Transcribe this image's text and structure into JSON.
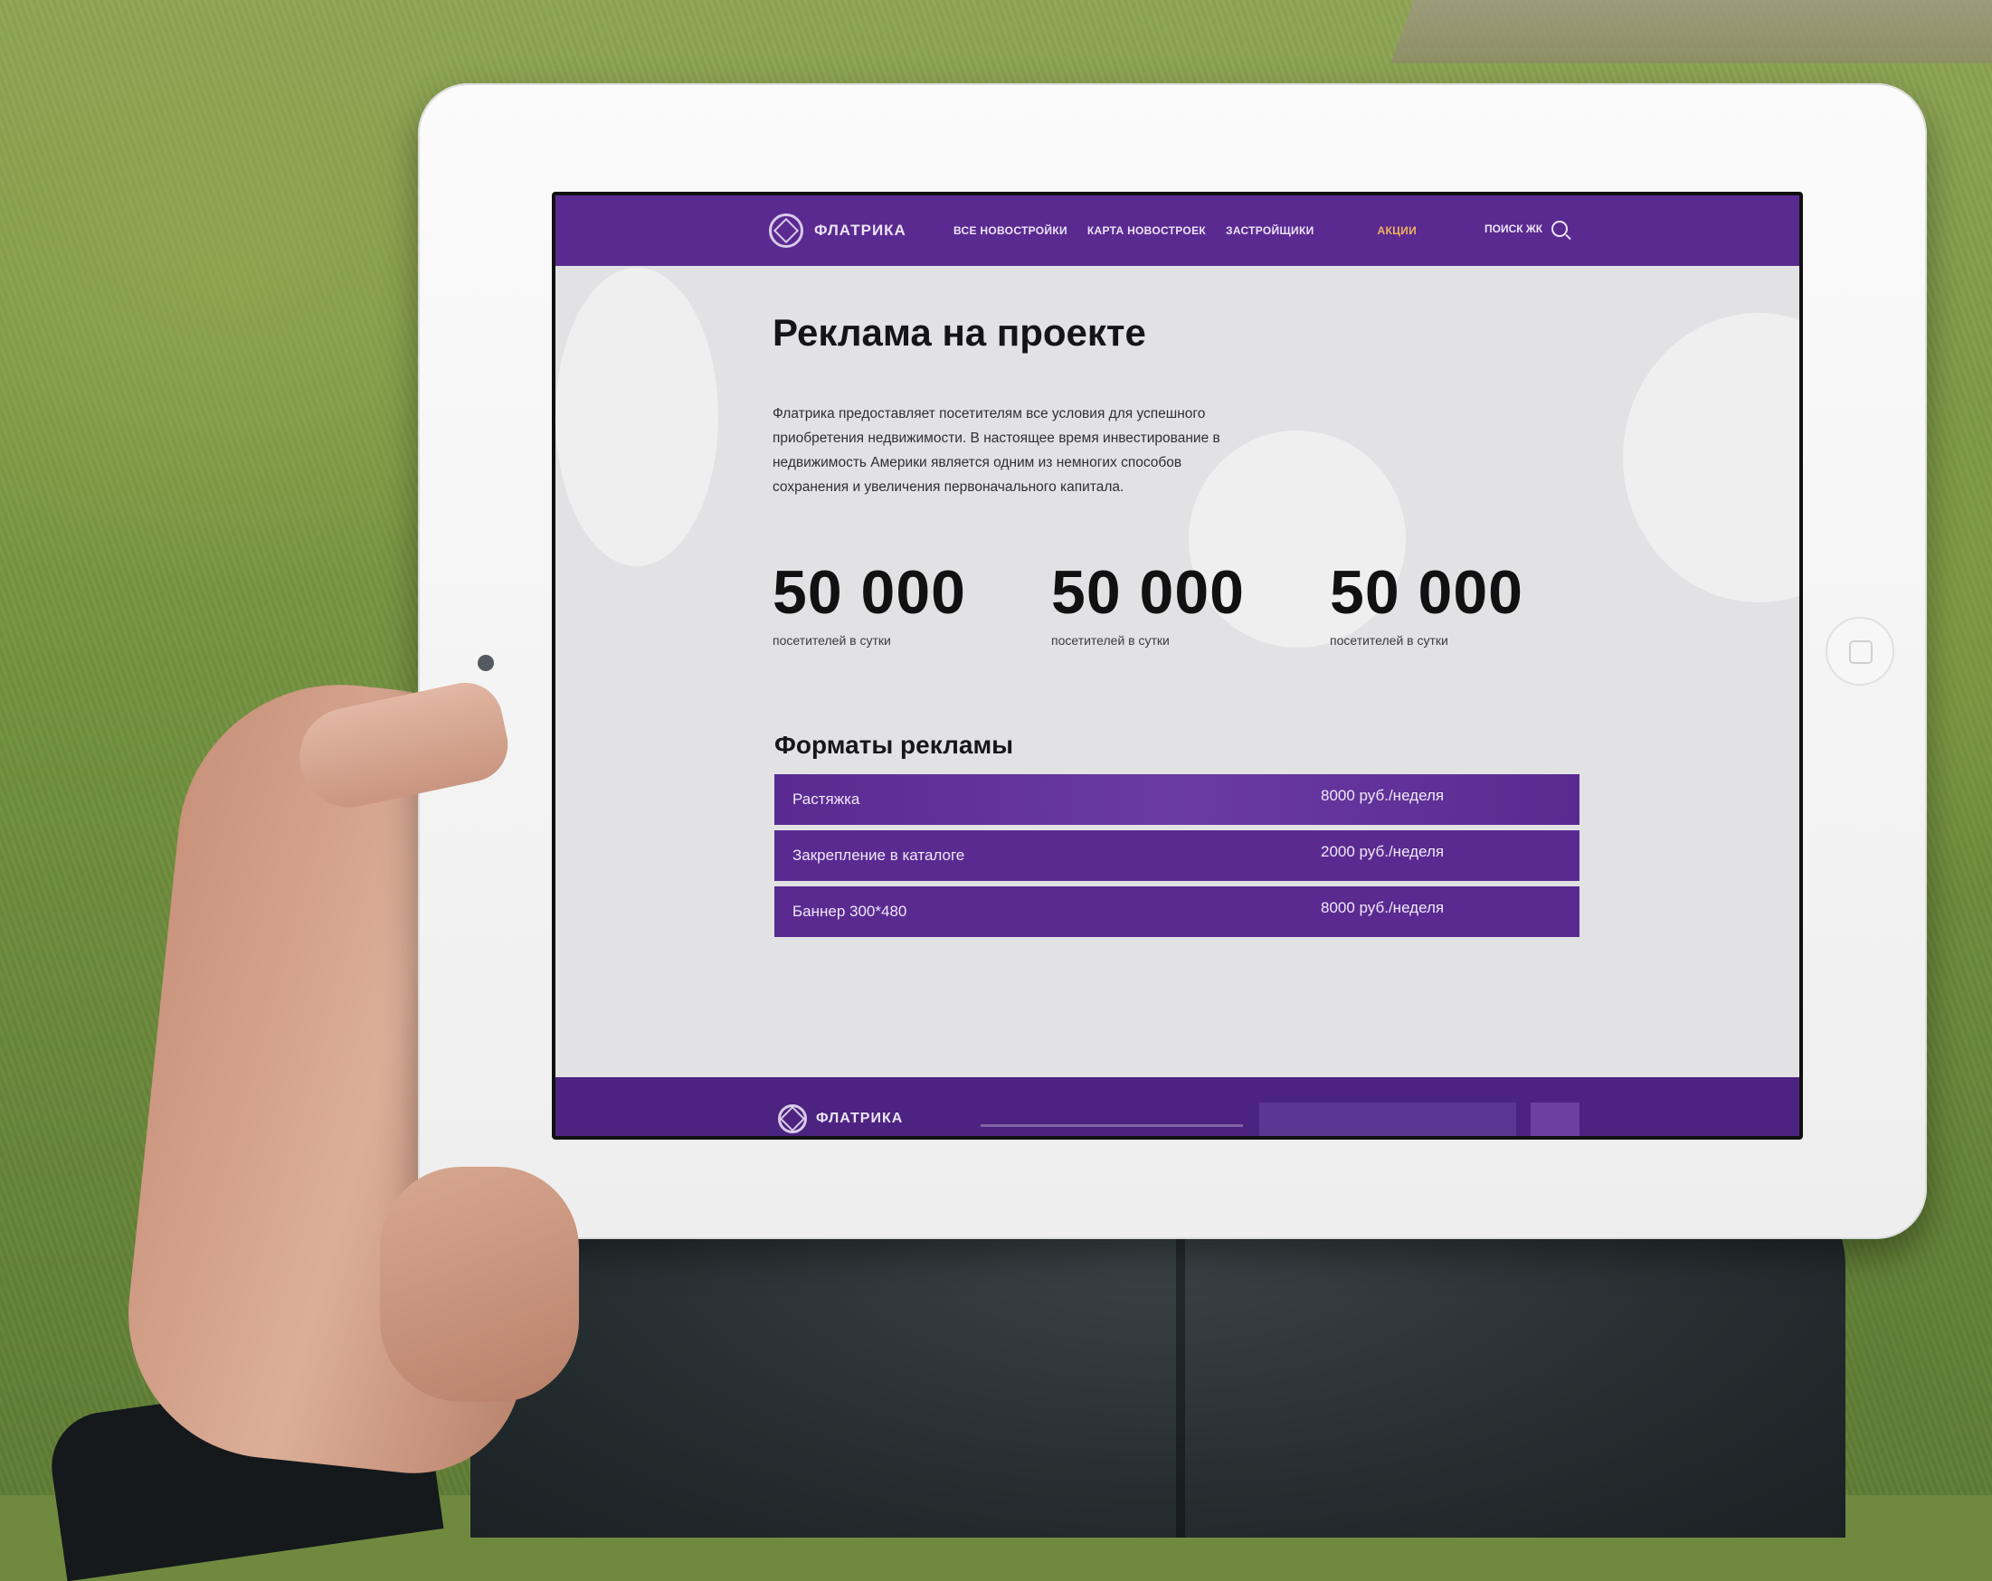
{
  "header": {
    "logo_text": "ФЛАТРИКА",
    "nav": [
      {
        "label": "ВСЕ НОВОСТРОЙКИ"
      },
      {
        "label": "КАРТА НОВОСТРОЕК"
      },
      {
        "label": "ЗАСТРОЙЩИКИ"
      },
      {
        "label": "АКЦИИ"
      }
    ],
    "search_label": "ПОИСК ЖК"
  },
  "main": {
    "title": "Реклама на проекте",
    "intro": "Флатрика предоставляет посетителям все условия для успешного приобретения недвижимости. В настоящее время инвестирование в недвижимость Америки является одним из немногих способов сохранения и увеличения первоначального капитала.",
    "stats": [
      {
        "value": "50 000",
        "label": "посетителей в сутки"
      },
      {
        "value": "50 000",
        "label": "посетителей в сутки"
      },
      {
        "value": "50 000",
        "label": "посетителей в сутки"
      }
    ],
    "formats_title": "Форматы рекламы",
    "formats": [
      {
        "name": "Растяжка",
        "price": "8000 руб./неделя"
      },
      {
        "name": "Закрепление в каталоге",
        "price": "2000 руб./неделя"
      },
      {
        "name": "Баннер 300*480",
        "price": "8000 руб./неделя"
      }
    ]
  },
  "footer": {
    "logo_text": "ФЛАТРИКА"
  },
  "colors": {
    "brand_purple": "#5a2a91",
    "active_nav": "#f2b45a",
    "page_background": "#e2e2e4"
  },
  "icons": [
    "logo-icon",
    "search-icon"
  ]
}
